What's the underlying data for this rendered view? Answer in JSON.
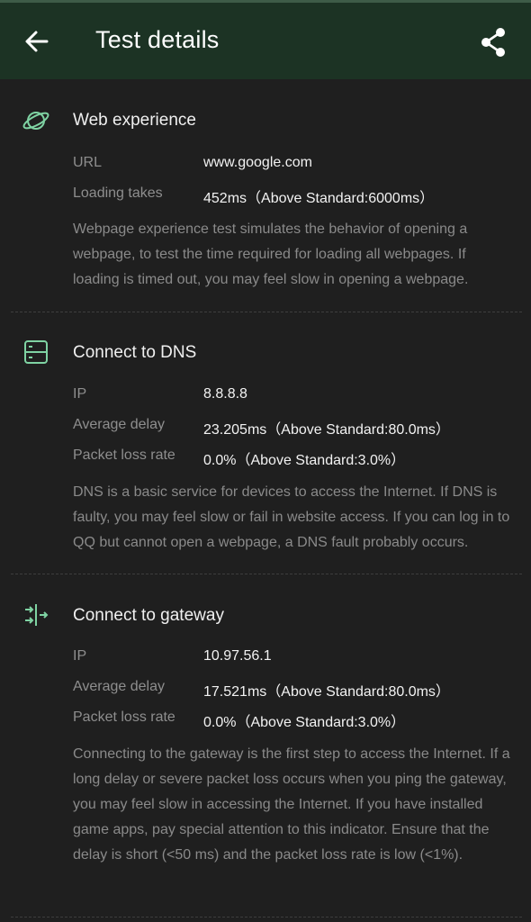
{
  "header": {
    "title": "Test details",
    "back_icon": "arrow-left-icon",
    "share_icon": "share-icon",
    "background": "#1c3324"
  },
  "sections": [
    {
      "icon": "planet-icon",
      "title": "Web experience",
      "rows": [
        {
          "label": "URL",
          "value": "www.google.com"
        },
        {
          "label": "Loading takes",
          "value": "452ms（Above Standard:6000ms）"
        }
      ],
      "description": "Webpage experience test simulates the behavior of opening a webpage, to test the time required for loading all webpages. If loading is timed out, you may feel slow in opening a webpage."
    },
    {
      "icon": "server-icon",
      "title": "Connect to DNS",
      "rows": [
        {
          "label": "IP",
          "value": "8.8.8.8"
        },
        {
          "label": "Average delay",
          "value": "23.205ms（Above Standard:80.0ms）"
        },
        {
          "label": "Packet loss rate",
          "value": "0.0%（Above Standard:3.0%）"
        }
      ],
      "description": "DNS is a basic service for devices to access the Internet. If DNS is faulty, you may feel slow or fail in website access. If you can log in to QQ but cannot open a webpage, a DNS fault probably occurs."
    },
    {
      "icon": "gateway-arrows-icon",
      "title": "Connect to gateway",
      "rows": [
        {
          "label": "IP",
          "value": "10.97.56.1"
        },
        {
          "label": "Average delay",
          "value": "17.521ms（Above Standard:80.0ms）"
        },
        {
          "label": "Packet loss rate",
          "value": "0.0%（Above Standard:3.0%）"
        }
      ],
      "description": "Connecting to the gateway is the first step to access the Internet. If a long delay or severe packet loss occurs when you ping the gateway, you may feel slow in accessing the Internet. If you have installed game apps, pay special attention to this indicator. Ensure that the delay is short (<50 ms) and the packet loss rate is low (<1%)."
    }
  ],
  "accent_color": "#7fd3a3"
}
